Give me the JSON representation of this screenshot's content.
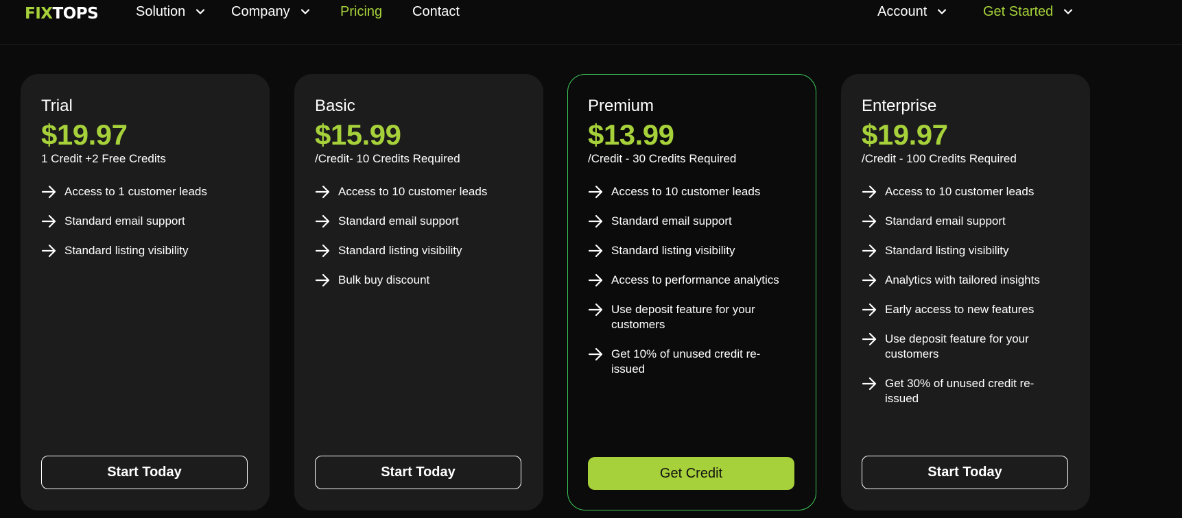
{
  "brand": {
    "logo_accent": "FIX",
    "logo_rest": "TOPS",
    "accent_color": "#a6d13a"
  },
  "nav": {
    "solution": "Solution",
    "company": "Company",
    "pricing": "Pricing",
    "contact": "Contact",
    "account": "Account",
    "get_started": "Get Started",
    "active": "Pricing"
  },
  "plans": [
    {
      "name": "Trial",
      "price": "$19.97",
      "note": "1 Credit +2 Free Credits",
      "features": [
        "Access to 1 customer leads",
        "Standard email support",
        "Standard listing visibility"
      ],
      "cta": "Start Today"
    },
    {
      "name": "Basic",
      "price": "$15.99",
      "note": "/Credit- 10 Credits Required",
      "features": [
        "Access to 10 customer leads",
        "Standard email support",
        "Standard listing visibility",
        "Bulk buy discount"
      ],
      "cta": "Start Today"
    },
    {
      "name": "Premium",
      "price": "$13.99",
      "note": "/Credit - 30 Credits Required",
      "features": [
        "Access to 10 customer leads",
        "Standard email support",
        "Standard listing visibility",
        "Access to performance analytics",
        "Use deposit feature for your customers",
        "Get 10% of unused credit re-issued"
      ],
      "cta": "Get Credit",
      "featured": true
    },
    {
      "name": "Enterprise",
      "price": "$19.97",
      "note": "/Credit - 100 Credits Required",
      "features": [
        "Access to 10 customer leads",
        "Standard email support",
        "Standard listing visibility",
        "Analytics with tailored insights",
        "Early access to new features",
        "Use deposit feature for your customers",
        "Get 30% of unused credit re-issued"
      ],
      "cta": "Start Today"
    }
  ],
  "icons": {
    "feature_bullet": "arrow-right-icon",
    "dropdown": "chevron-down-icon"
  }
}
